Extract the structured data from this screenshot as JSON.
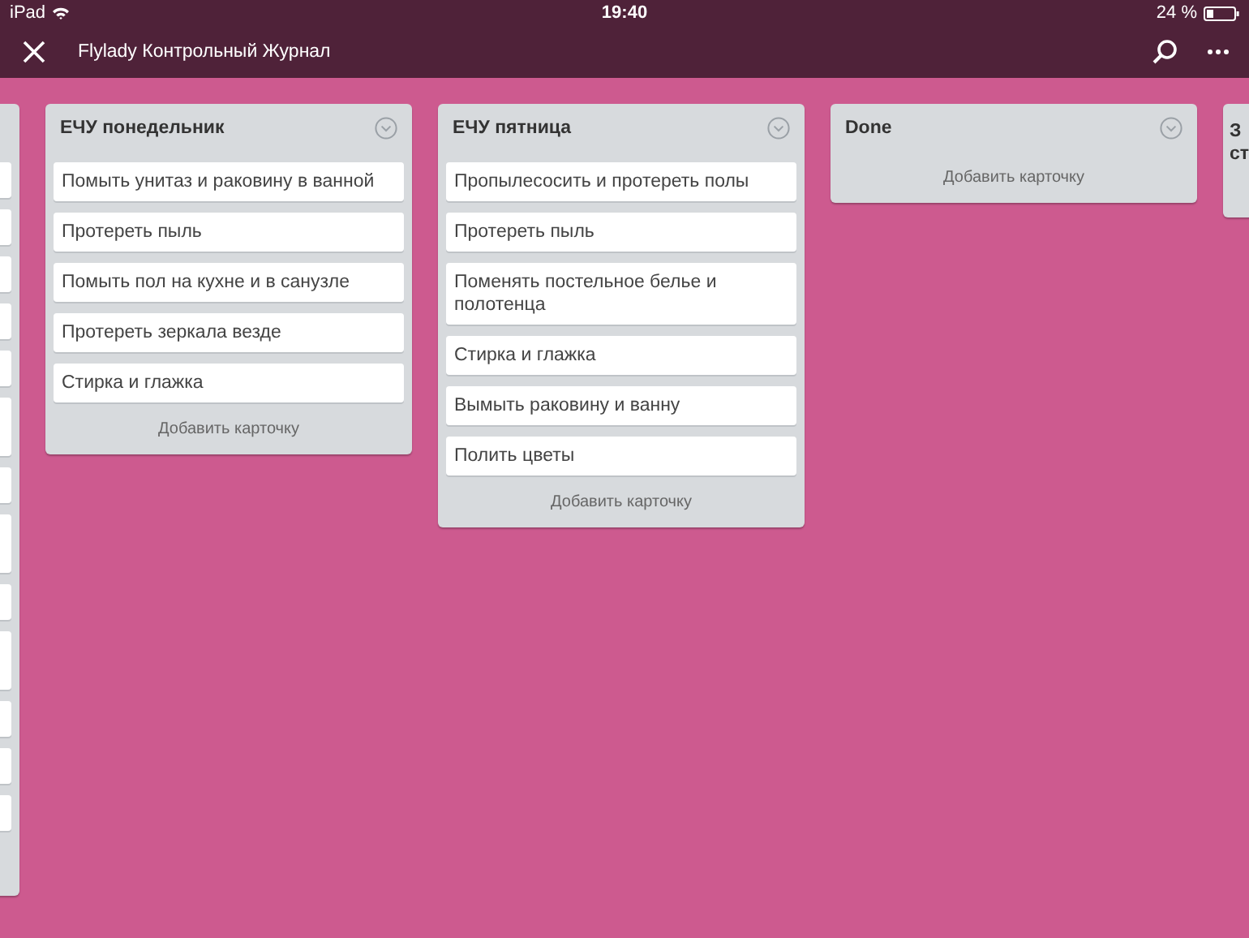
{
  "status_bar": {
    "device": "iPad",
    "time": "19:40",
    "battery": "24 %"
  },
  "nav_bar": {
    "title": "Flylady Контрольный Журнал"
  },
  "cropped_list": {
    "cards": [
      {
        "kind": "short"
      },
      {
        "kind": "short"
      },
      {
        "kind": "short"
      },
      {
        "kind": "short"
      },
      {
        "kind": "short"
      },
      {
        "kind": "tall"
      },
      {
        "kind": "short"
      },
      {
        "kind": "tall"
      },
      {
        "kind": "short"
      },
      {
        "kind": "tall"
      },
      {
        "kind": "short"
      },
      {
        "kind": "short"
      },
      {
        "kind": "short"
      }
    ]
  },
  "lists": [
    {
      "title": "ЕЧУ понедельник",
      "cards": [
        "Помыть унитаз и раковину в ванной",
        "Протереть пыль",
        "Помыть пол на кухне и в санузле",
        "Протереть зеркала везде",
        "Стирка и глажка"
      ],
      "add_card": "Добавить карточку"
    },
    {
      "title": "ЕЧУ пятница",
      "cards": [
        "Пропылесосить и протереть полы",
        "Протереть пыль",
        "Поменять постельное белье и полотенца",
        "Стирка и глажка",
        "Вымыть раковину и ванну",
        "Полить цветы"
      ],
      "add_card": "Добавить карточку"
    },
    {
      "title": "Done",
      "add_card": "Добавить карточку"
    }
  ],
  "partial_list": {
    "title": "З ст"
  }
}
